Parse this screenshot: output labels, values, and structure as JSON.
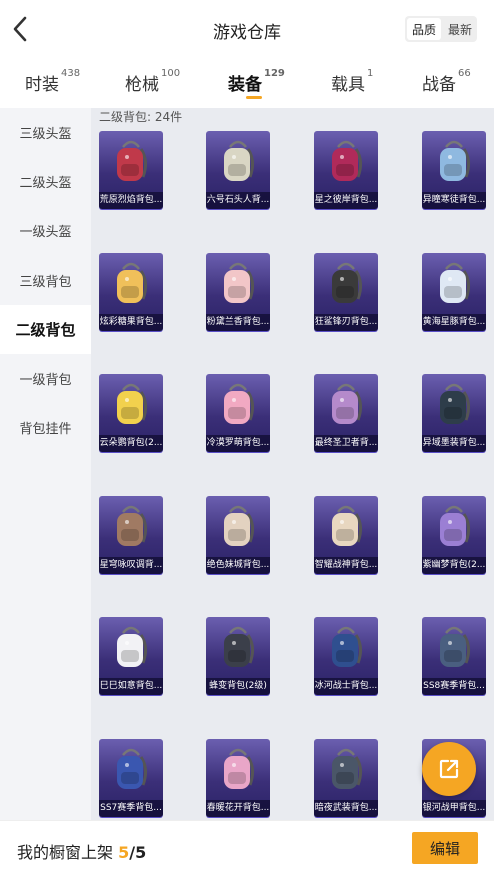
{
  "header": {
    "title": "游戏仓库",
    "sort_options": [
      "品质",
      "最新"
    ],
    "sort_active": "品质"
  },
  "tabs": [
    {
      "label": "时装",
      "count": "438",
      "active": false
    },
    {
      "label": "枪械",
      "count": "100",
      "active": false
    },
    {
      "label": "装备",
      "count": "129",
      "active": true
    },
    {
      "label": "载具",
      "count": "1",
      "active": false
    },
    {
      "label": "战备",
      "count": "66",
      "active": false
    }
  ],
  "sidebar": {
    "items": [
      "三级头盔",
      "二级头盔",
      "一级头盔",
      "三级背包",
      "二级背包",
      "一级背包",
      "背包挂件"
    ],
    "active": "二级背包"
  },
  "main": {
    "count_label": "二级背包: 24件",
    "items": [
      {
        "name": "荒原烈焰背包...",
        "color": "#c0394a"
      },
      {
        "name": "六号石头人背...",
        "color": "#d9d6c4"
      },
      {
        "name": "星之彼岸背包...",
        "color": "#b02a5a"
      },
      {
        "name": "异瞳寒徒背包...",
        "color": "#8fb9e0"
      },
      {
        "name": "炫彩糖果背包...",
        "color": "#f0c05a"
      },
      {
        "name": "粉黛兰香背包...",
        "color": "#f2c6c8"
      },
      {
        "name": "狂鲨锋刃背包...",
        "color": "#3a3a3a"
      },
      {
        "name": "黄海星豚背包...",
        "color": "#dfe8f4"
      },
      {
        "name": "云朵鹦背包(2...",
        "color": "#f2d14d"
      },
      {
        "name": "冷漠罗萌背包...",
        "color": "#f1a9c2"
      },
      {
        "name": "最终圣卫者背...",
        "color": "#b58acb"
      },
      {
        "name": "异域墨装背包...",
        "color": "#2e3d4a"
      },
      {
        "name": "星穹咏叹调背...",
        "color": "#a07a63"
      },
      {
        "name": "绝色妹城背包...",
        "color": "#e3d2c0"
      },
      {
        "name": "智耀战神背包...",
        "color": "#e8d7c0"
      },
      {
        "name": "紫幽梦背包(2...",
        "color": "#9b7fd4"
      },
      {
        "name": "巳巳如意背包...",
        "color": "#f2f2f5"
      },
      {
        "name": "蜂变背包(2级)",
        "color": "#3b3f4a"
      },
      {
        "name": "冰河战士背包...",
        "color": "#2f4f8f"
      },
      {
        "name": "SS8赛季背包...",
        "color": "#4a5f80"
      },
      {
        "name": "SS7赛季背包...",
        "color": "#3a57b0"
      },
      {
        "name": "春暖花开背包...",
        "color": "#e9a6c8"
      },
      {
        "name": "暗夜武装背包...",
        "color": "#4a5668"
      },
      {
        "name": "银河战甲背包...",
        "color": "#6a8fb0"
      }
    ]
  },
  "footer": {
    "label": "我的橱窗上架",
    "current": "5",
    "separator": "/",
    "total": "5",
    "edit_label": "编辑"
  },
  "colors": {
    "accent": "#f5a623",
    "card_top": "#6b5fb0",
    "card_bottom": "#2a2266"
  },
  "icons": {
    "back": "chevron-left-icon",
    "share": "share-out-icon"
  }
}
